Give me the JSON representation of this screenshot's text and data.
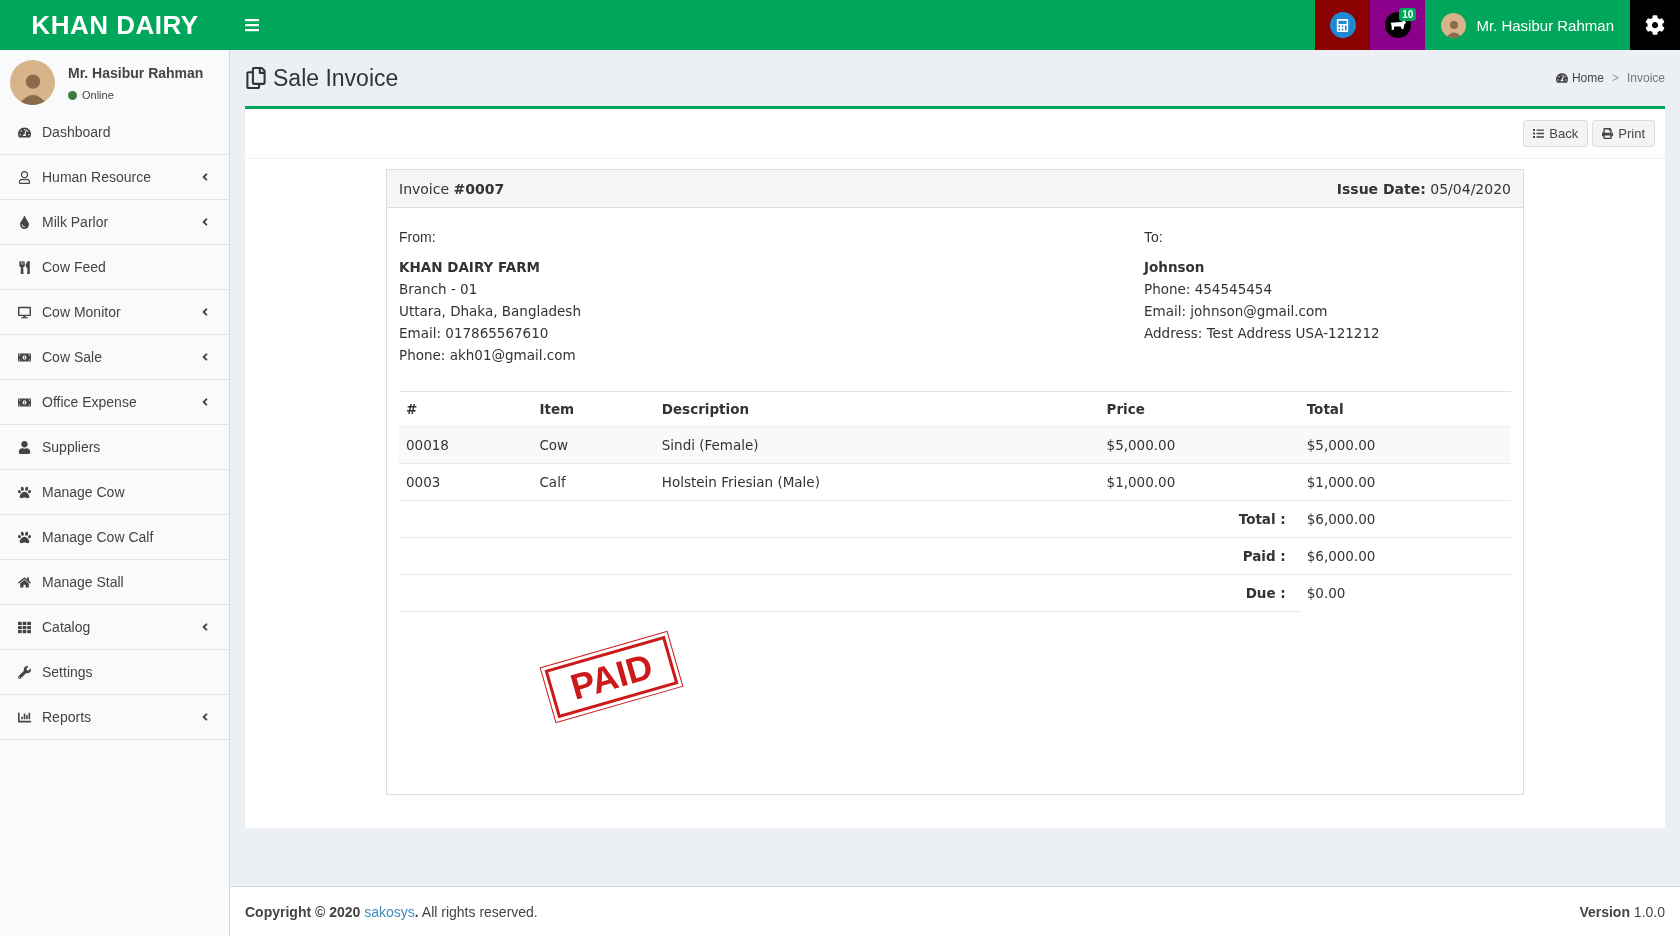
{
  "topbar": {
    "brand": "KHAN DAIRY",
    "user_name": "Mr. Hasibur Rahman",
    "notification_count": "10"
  },
  "sidebar": {
    "user": {
      "name": "Mr. Hasibur Rahman",
      "status": "Online"
    },
    "items": [
      {
        "label": "Dashboard",
        "has_submenu": false
      },
      {
        "label": "Human Resource",
        "has_submenu": true
      },
      {
        "label": "Milk Parlor",
        "has_submenu": true
      },
      {
        "label": "Cow Feed",
        "has_submenu": false
      },
      {
        "label": "Cow Monitor",
        "has_submenu": true
      },
      {
        "label": "Cow Sale",
        "has_submenu": true
      },
      {
        "label": "Office Expense",
        "has_submenu": true
      },
      {
        "label": "Suppliers",
        "has_submenu": false
      },
      {
        "label": "Manage Cow",
        "has_submenu": false
      },
      {
        "label": "Manage Cow Calf",
        "has_submenu": false
      },
      {
        "label": "Manage Stall",
        "has_submenu": false
      },
      {
        "label": "Catalog",
        "has_submenu": true
      },
      {
        "label": "Settings",
        "has_submenu": false
      },
      {
        "label": "Reports",
        "has_submenu": true
      }
    ]
  },
  "page": {
    "title": "Sale Invoice",
    "breadcrumb": [
      "Home",
      "Invoice"
    ],
    "breadcrumb_separator": ">"
  },
  "toolbar": {
    "buttons": [
      "Back",
      "Print"
    ]
  },
  "invoice": {
    "number": "Invoice **#0007**",
    "issue_date": "**Issue Date:** 05/04/2020",
    "from": {
      "label": "From:",
      "name": "KHAN DAIRY FARM",
      "lines": [
        "Branch - 01",
        "Uttara, Dhaka, Bangladesh",
        "Email: 017865567610",
        "Phone: akh01@gmail.com"
      ]
    },
    "to": {
      "label": "To:",
      "name": "Johnson",
      "lines": [
        "Phone: 454545454",
        "Email: johnson@gmail.com",
        "Address: Test Address USA-121212"
      ]
    },
    "table": {
      "columns": [
        "#",
        "Item",
        "Description",
        "Price",
        "Total"
      ],
      "rows": [
        [
          "00018",
          "Cow",
          "Sindi (Female)",
          "$5,000.00",
          "$5,000.00"
        ],
        [
          "0003",
          "Calf",
          "Holstein Friesian (Male)",
          "$1,000.00",
          "$1,000.00"
        ]
      ]
    },
    "summary": [
      {
        "label": "Total :",
        "value": "$6,000.00"
      },
      {
        "label": "Paid :",
        "value": "$6,000.00"
      },
      {
        "label": "Due :",
        "value": "$0.00"
      }
    ],
    "stamp": "PAID"
  },
  "footer": {
    "copyright": "Copyright © 2020",
    "link": "sakosys",
    "suffix": "**.** All rights reserved.",
    "version": "**Version** 1.0.0"
  }
}
